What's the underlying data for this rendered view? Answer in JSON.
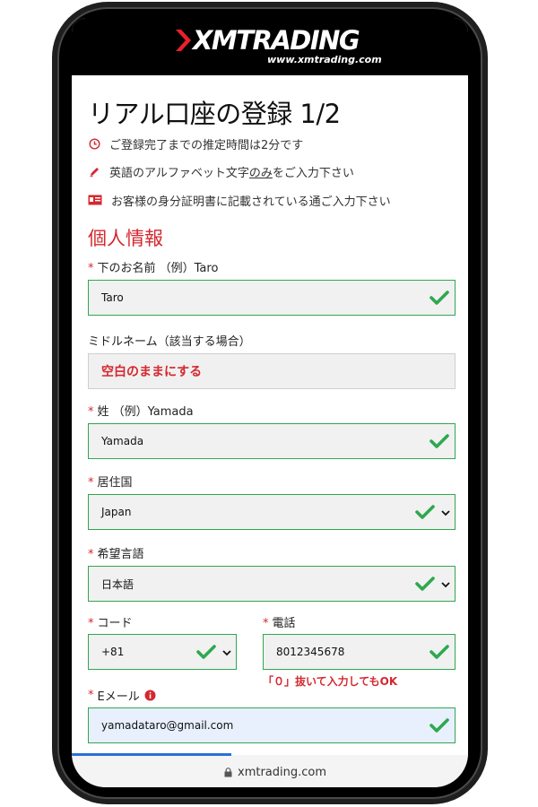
{
  "brand": {
    "logo_text": "XMTRADING",
    "url_text": "www.xmtrading.com"
  },
  "page": {
    "title": "リアル口座の登録 1/2"
  },
  "notices": [
    {
      "icon": "clock-icon",
      "text_before": "ご登録完了までの推定時間は2分です",
      "underlined": "",
      "text_after": ""
    },
    {
      "icon": "pencil-icon",
      "text_before": "英語のアルファベット文字",
      "underlined": "のみ",
      "text_after": "をご入力下さい"
    },
    {
      "icon": "id-card-icon",
      "text_before": "お客様の身分証明書に記載されている通ご入力下さい",
      "underlined": "",
      "text_after": ""
    }
  ],
  "section": {
    "title": "個人情報"
  },
  "form": {
    "required_mark": "*",
    "first_name": {
      "label": "下のお名前 （例）Taro",
      "value": "Taro"
    },
    "middle_name": {
      "label": "ミドルネーム（該当する場合）",
      "note": "空白のままにする"
    },
    "last_name": {
      "label": "姓 （例）Yamada",
      "value": "Yamada"
    },
    "country": {
      "label": "居住国",
      "value": "Japan"
    },
    "language": {
      "label": "希望言語",
      "value": "日本語"
    },
    "code": {
      "label": "コード",
      "value": "+81"
    },
    "phone": {
      "label": "電話",
      "value": "8012345678",
      "hint": "「０」抜いて入力してもOK"
    },
    "email": {
      "label": "Eメール",
      "value": "yamadataro@gmail.com"
    }
  },
  "browser": {
    "url": "xmtrading.com"
  },
  "colors": {
    "accent_red": "#d4282f",
    "valid_green": "#2fa84f",
    "brand_bg": "#000000",
    "progress_blue": "#2b6fd6"
  }
}
